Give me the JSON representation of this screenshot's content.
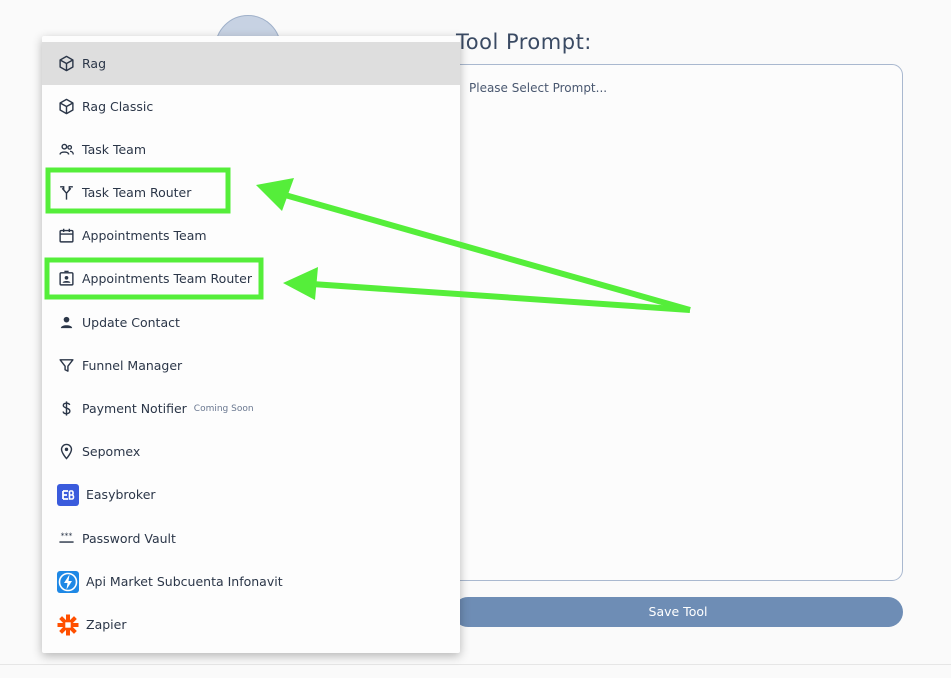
{
  "form": {
    "prompt_title": "Tool Prompt:",
    "prompt_placeholder": "Please Select Prompt...",
    "save_label": "Save Tool"
  },
  "menu": {
    "items": [
      {
        "label": "Rag",
        "icon": "cube-icon",
        "selected": true
      },
      {
        "label": "Rag Classic",
        "icon": "cube-icon"
      },
      {
        "label": "Task Team",
        "icon": "people-icon"
      },
      {
        "label": "Task Team Router",
        "icon": "fork-icon",
        "highlighted": true
      },
      {
        "label": "Appointments Team",
        "icon": "calendar-icon"
      },
      {
        "label": "Appointments Team Router",
        "icon": "badge-icon",
        "highlighted": true
      },
      {
        "label": "Update Contact",
        "icon": "person-icon"
      },
      {
        "label": "Funnel Manager",
        "icon": "filter-icon"
      },
      {
        "label": "Payment Notifier",
        "icon": "dollar-icon",
        "badge": "Coming Soon"
      },
      {
        "label": "Sepomex",
        "icon": "location-pin-icon"
      },
      {
        "label": "Easybroker",
        "icon": "easybroker-logo-icon"
      },
      {
        "label": "Password Vault",
        "icon": "password-dots-icon"
      },
      {
        "label": "Api Market Subcuenta Infonavit",
        "icon": "lightning-bolt-icon"
      },
      {
        "label": "Zapier",
        "icon": "zapier-logo-icon"
      }
    ]
  },
  "colors": {
    "accent": "#6e8db5",
    "annotation": "#55ee3a",
    "selected_bg": "#dedede",
    "text": "#2b3648",
    "easybroker": "#3a5bdc",
    "api_market": "#1e88e5",
    "zapier": "#ff4f00"
  }
}
